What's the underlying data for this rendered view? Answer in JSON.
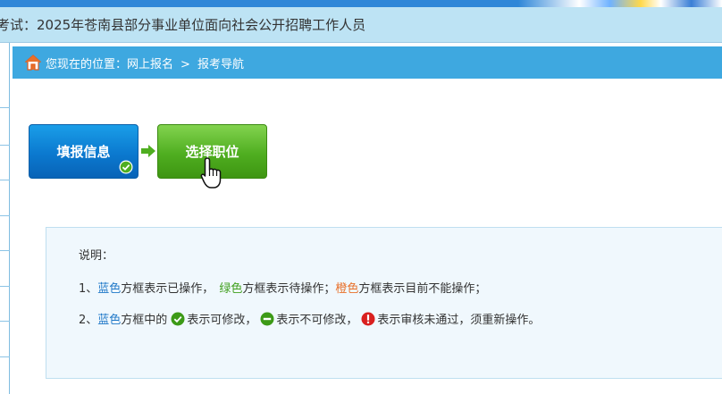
{
  "exam_title": "考试：2025年苍南县部分事业单位面向社会公开招聘工作人员",
  "breadcrumb": {
    "prefix": "您现在的位置：",
    "items": [
      "网上报名",
      "报考导航"
    ],
    "separator": ">"
  },
  "steps": [
    {
      "label": "填报信息",
      "state": "completed",
      "color": "#0b79cf"
    },
    {
      "label": "选择职位",
      "state": "pending",
      "color": "#4fae20"
    }
  ],
  "notes": {
    "title": "说明：",
    "line1": {
      "num": "1、",
      "blue": "蓝色",
      "blue_desc": "方框表示已操作，",
      "green": "绿色",
      "green_desc": "方框表示待操作；",
      "orange": "橙色",
      "orange_desc": "方框表示目前不能操作；"
    },
    "line2": {
      "num": "2、",
      "blue": "蓝色",
      "blue_desc": "方框中的",
      "ok_desc": "表示可修改，",
      "minus_desc": "表示不可修改，",
      "error_desc": "表示审核未通过，须重新操作。"
    }
  },
  "colors": {
    "crumb_bar": "#3ea8e0",
    "title_bar": "#bde3f4",
    "blue_text": "#1f78c8",
    "green_text": "#3f9f1c",
    "orange_text": "#e8702a"
  }
}
